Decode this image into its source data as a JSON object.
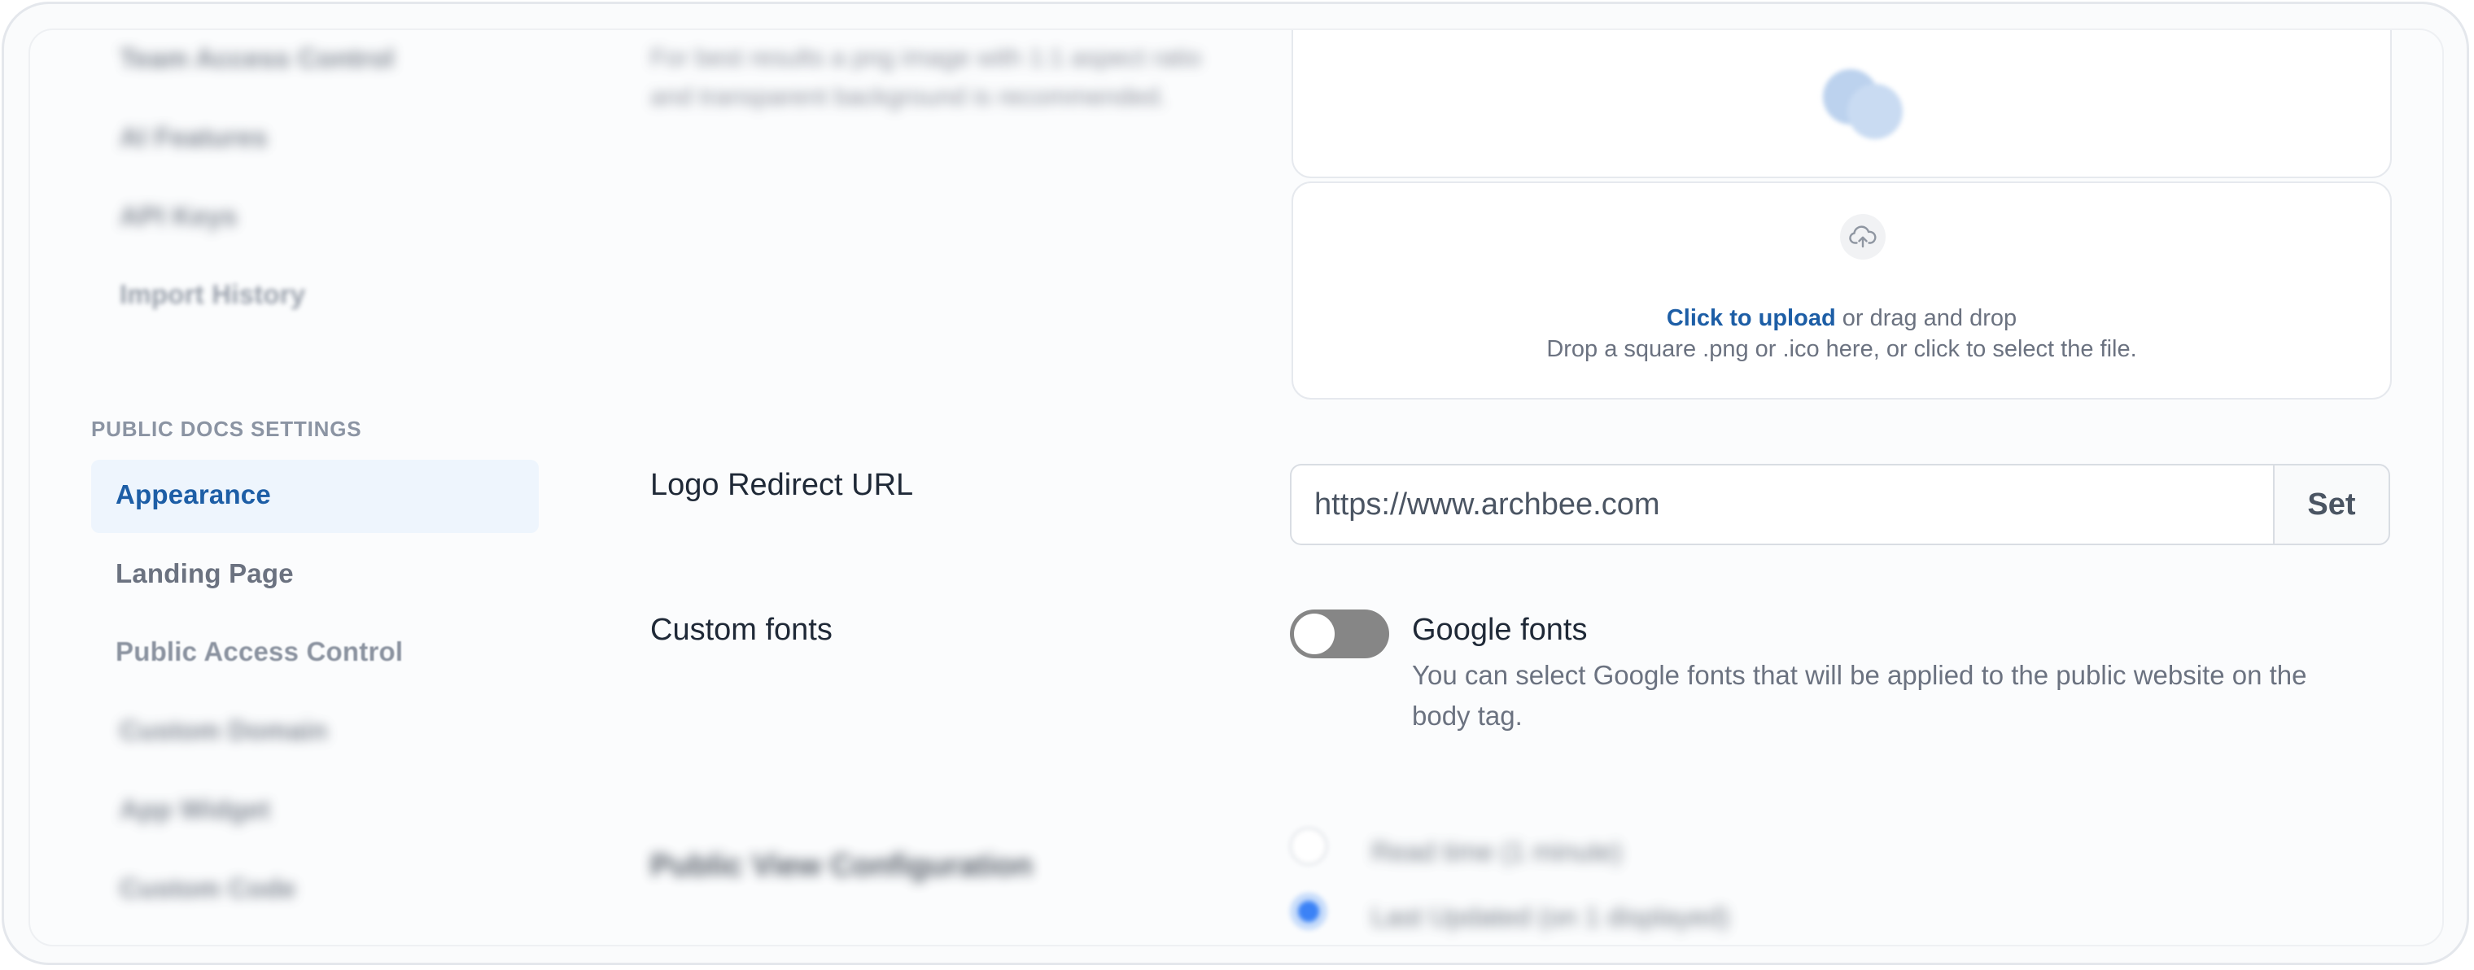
{
  "sidebar": {
    "top_items": [
      {
        "label": "Team Access Control"
      },
      {
        "label": "AI Features"
      },
      {
        "label": "API Keys"
      },
      {
        "label": "Import History"
      }
    ],
    "section_title": "PUBLIC DOCS SETTINGS",
    "items": [
      {
        "label": "Appearance",
        "active": true
      },
      {
        "label": "Landing Page"
      },
      {
        "label": "Public Access Control"
      },
      {
        "label": "Custom Domain"
      },
      {
        "label": "App Widget"
      },
      {
        "label": "Custom Code"
      }
    ]
  },
  "favicon": {
    "description": "For best results a png image with 1:1 aspect ratio and transparent background is recommended.",
    "upload_link": "Click to upload",
    "upload_rest": " or drag and drop",
    "upload_hint": "Drop a square .png or .ico here, or click to select the file."
  },
  "logo_redirect": {
    "label": "Logo Redirect URL",
    "value": "https://www.archbee.com",
    "button": "Set"
  },
  "custom_fonts": {
    "label": "Custom fonts",
    "toggle_title": "Google fonts",
    "toggle_on": false,
    "description": "You can select Google fonts that will be applied to the public website on the body tag."
  },
  "public_view": {
    "label": "Public View Configuration",
    "options": [
      {
        "label": "Read time (1 minute)",
        "selected": false
      },
      {
        "label": "Last Updated (on 1 displayed)",
        "selected": true
      }
    ]
  },
  "colors": {
    "accent": "#1d5ea6",
    "active_bg": "#eef5fd",
    "toggle_off": "#868686"
  }
}
